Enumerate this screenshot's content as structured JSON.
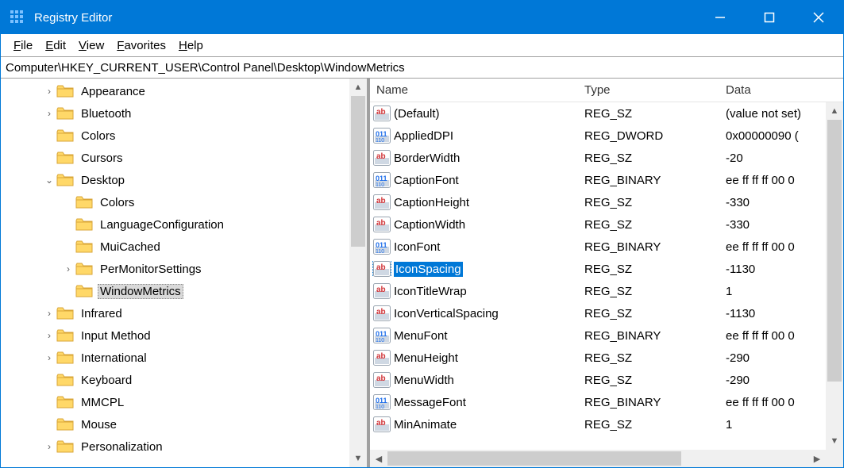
{
  "titlebar": {
    "title": "Registry Editor"
  },
  "menubar": {
    "items": [
      {
        "hot": "F",
        "rest": "ile"
      },
      {
        "hot": "E",
        "rest": "dit"
      },
      {
        "hot": "V",
        "rest": "iew"
      },
      {
        "hot": "F",
        "rest": "avorites"
      },
      {
        "hot": "H",
        "rest": "elp"
      }
    ]
  },
  "addressbar": {
    "path": "Computer\\HKEY_CURRENT_USER\\Control Panel\\Desktop\\WindowMetrics"
  },
  "tree": {
    "selected_label": "WindowMetrics",
    "items": [
      {
        "depth": 2,
        "expander": "closed",
        "label": "Appearance"
      },
      {
        "depth": 2,
        "expander": "closed",
        "label": "Bluetooth"
      },
      {
        "depth": 2,
        "expander": "none",
        "label": "Colors"
      },
      {
        "depth": 2,
        "expander": "none",
        "label": "Cursors"
      },
      {
        "depth": 2,
        "expander": "open",
        "label": "Desktop"
      },
      {
        "depth": 3,
        "expander": "none",
        "label": "Colors"
      },
      {
        "depth": 3,
        "expander": "none",
        "label": "LanguageConfiguration"
      },
      {
        "depth": 3,
        "expander": "none",
        "label": "MuiCached"
      },
      {
        "depth": 3,
        "expander": "closed",
        "label": "PerMonitorSettings"
      },
      {
        "depth": 3,
        "expander": "none",
        "label": "WindowMetrics",
        "selected": true
      },
      {
        "depth": 2,
        "expander": "closed",
        "label": "Infrared"
      },
      {
        "depth": 2,
        "expander": "closed",
        "label": "Input Method"
      },
      {
        "depth": 2,
        "expander": "closed",
        "label": "International"
      },
      {
        "depth": 2,
        "expander": "none",
        "label": "Keyboard"
      },
      {
        "depth": 2,
        "expander": "none",
        "label": "MMCPL"
      },
      {
        "depth": 2,
        "expander": "none",
        "label": "Mouse"
      },
      {
        "depth": 2,
        "expander": "closed",
        "label": "Personalization"
      }
    ]
  },
  "list": {
    "headers": {
      "name": "Name",
      "type": "Type",
      "data": "Data"
    },
    "selected_index": 7,
    "items": [
      {
        "icon": "sz",
        "name": "(Default)",
        "type": "REG_SZ",
        "data": "(value not set)"
      },
      {
        "icon": "bin",
        "name": "AppliedDPI",
        "type": "REG_DWORD",
        "data": "0x00000090 ("
      },
      {
        "icon": "sz",
        "name": "BorderWidth",
        "type": "REG_SZ",
        "data": "-20"
      },
      {
        "icon": "bin",
        "name": "CaptionFont",
        "type": "REG_BINARY",
        "data": "ee ff ff ff 00 0"
      },
      {
        "icon": "sz",
        "name": "CaptionHeight",
        "type": "REG_SZ",
        "data": "-330"
      },
      {
        "icon": "sz",
        "name": "CaptionWidth",
        "type": "REG_SZ",
        "data": "-330"
      },
      {
        "icon": "bin",
        "name": "IconFont",
        "type": "REG_BINARY",
        "data": "ee ff ff ff 00 0"
      },
      {
        "icon": "sz",
        "name": "IconSpacing",
        "type": "REG_SZ",
        "data": "-1130"
      },
      {
        "icon": "sz",
        "name": "IconTitleWrap",
        "type": "REG_SZ",
        "data": "1"
      },
      {
        "icon": "sz",
        "name": "IconVerticalSpacing",
        "type": "REG_SZ",
        "data": "-1130"
      },
      {
        "icon": "bin",
        "name": "MenuFont",
        "type": "REG_BINARY",
        "data": "ee ff ff ff 00 0"
      },
      {
        "icon": "sz",
        "name": "MenuHeight",
        "type": "REG_SZ",
        "data": "-290"
      },
      {
        "icon": "sz",
        "name": "MenuWidth",
        "type": "REG_SZ",
        "data": "-290"
      },
      {
        "icon": "bin",
        "name": "MessageFont",
        "type": "REG_BINARY",
        "data": "ee ff ff ff 00 0"
      },
      {
        "icon": "sz",
        "name": "MinAnimate",
        "type": "REG_SZ",
        "data": "1"
      }
    ]
  }
}
